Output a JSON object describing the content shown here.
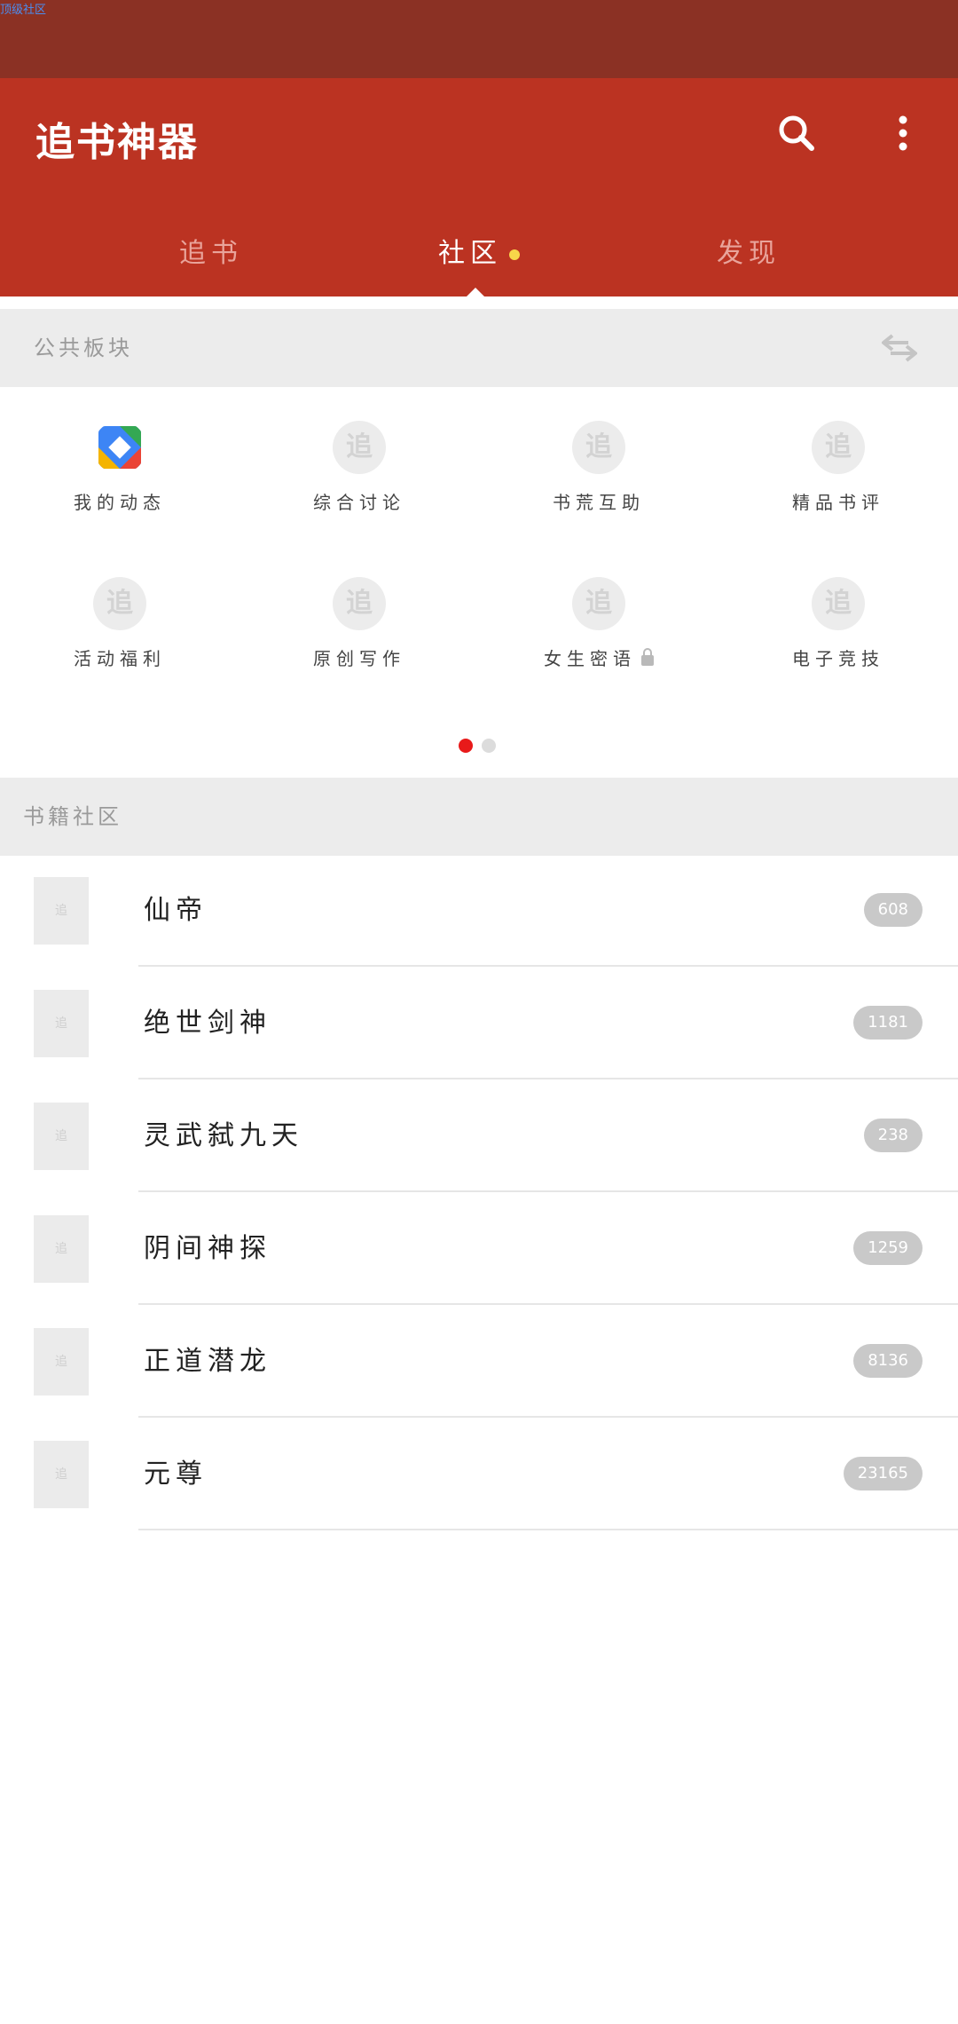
{
  "statusbar": {
    "tiny_text": "顶级社区"
  },
  "app": {
    "title": "追书神器"
  },
  "tabs": [
    {
      "label": "追书",
      "active": false
    },
    {
      "label": "社区",
      "active": true,
      "has_dot": true
    },
    {
      "label": "发现",
      "active": false
    }
  ],
  "public_section": {
    "label": "公共板块"
  },
  "forums": [
    {
      "label": "我的动态",
      "icon": "colorful-app-icon"
    },
    {
      "label": "综合讨论",
      "icon": "zhui-logo-icon"
    },
    {
      "label": "书荒互助",
      "icon": "zhui-logo-icon"
    },
    {
      "label": "精品书评",
      "icon": "zhui-logo-icon"
    },
    {
      "label": "活动福利",
      "icon": "zhui-logo-icon"
    },
    {
      "label": "原创写作",
      "icon": "zhui-logo-icon"
    },
    {
      "label": "女生密语",
      "icon": "zhui-logo-icon",
      "locked": true
    },
    {
      "label": "电子竞技",
      "icon": "zhui-logo-icon"
    }
  ],
  "pager": {
    "pages": 2,
    "current": 1
  },
  "book_section": {
    "label": "书籍社区"
  },
  "books": [
    {
      "name": "仙帝",
      "count": "608"
    },
    {
      "name": "绝世剑神",
      "count": "1181"
    },
    {
      "name": "灵武弑九天",
      "count": "238"
    },
    {
      "name": "阴间神探",
      "count": "1259"
    },
    {
      "name": "正道潜龙",
      "count": "8136"
    },
    {
      "name": "元尊",
      "count": "23165"
    }
  ],
  "placeholder_glyph": "追",
  "colors": {
    "brand_red": "#bb3322",
    "status_red": "#8b3124",
    "pager_active": "#e81a1a",
    "new_dot": "#f7d64a"
  }
}
